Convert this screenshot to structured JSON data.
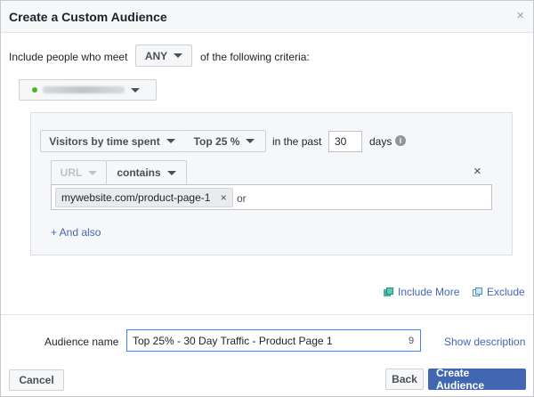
{
  "dialog": {
    "title": "Create a Custom Audience",
    "close_glyph": "×"
  },
  "criteria": {
    "prefix": "Include people who meet",
    "match_mode": "ANY",
    "suffix": "of the following criteria:"
  },
  "source": {
    "selected": "pixel"
  },
  "rule": {
    "event": "Visitors by time spent",
    "percentile": "Top 25 %",
    "in_past_label": "in the past",
    "days_value": "30",
    "days_label": "days",
    "info_glyph": "i",
    "field": "URL",
    "operator": "contains",
    "remove_glyph": "×",
    "url_token": "mywebsite.com/product-page-1",
    "token_remove_glyph": "×",
    "or_label": "or",
    "and_also": "+ And also"
  },
  "actions": {
    "include_more": "Include More",
    "exclude": "Exclude"
  },
  "audience": {
    "label": "Audience name",
    "value": "Top 25% - 30 Day Traffic - Product Page 1",
    "char_count": "9",
    "show_description": "Show description"
  },
  "footer": {
    "cancel": "Cancel",
    "back": "Back",
    "create": "Create Audience"
  },
  "colors": {
    "primary": "#4267b2",
    "link": "#4267b2",
    "panel_bg": "#f6f7f9",
    "status_green": "#42b72a"
  }
}
